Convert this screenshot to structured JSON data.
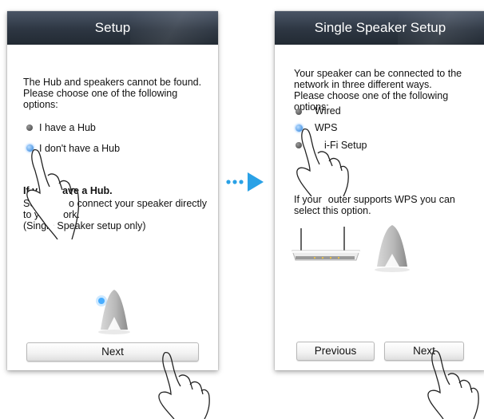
{
  "left_screen": {
    "title": "Setup",
    "message": [
      "The Hub and speakers cannot be found.",
      "Please choose one of the following",
      "options:"
    ],
    "options": [
      {
        "label": "I have a Hub",
        "selected": false
      },
      {
        "label": "I don't have a Hub",
        "selected": true
      }
    ],
    "info_heading_visible": [
      "If y",
      "ave a Hub."
    ],
    "info_lines_visible": [
      "Sele",
      "o connect your speaker directly",
      "to you",
      "ork.",
      "(Single Speaker setup only)"
    ],
    "next_label": "Next"
  },
  "right_screen": {
    "title": "Single Speaker Setup",
    "message": [
      "Your speaker can be connected to the",
      "network in three different ways.",
      "Please choose one of the following options:"
    ],
    "options": [
      {
        "label": "Wired",
        "selected": false
      },
      {
        "label": "WPS",
        "selected": true
      },
      {
        "label": "Wi-Fi Setup",
        "selected": false
      }
    ],
    "option_visible_texts": [
      "Wired",
      "WPS",
      "i-Fi Setup"
    ],
    "hint_visible": [
      "If your",
      "outer supports WPS you can"
    ],
    "hint_line2": "select this option.",
    "previous_label": "Previous",
    "next_label": "Next"
  },
  "icons": [
    "hand-pointer-icon",
    "speaker-icon",
    "router-icon",
    "arrow-right-icon"
  ],
  "colors": {
    "accent": "#2aa1e6",
    "titlebar": "#2d3642",
    "radio_selected": "#2a7fd8"
  }
}
